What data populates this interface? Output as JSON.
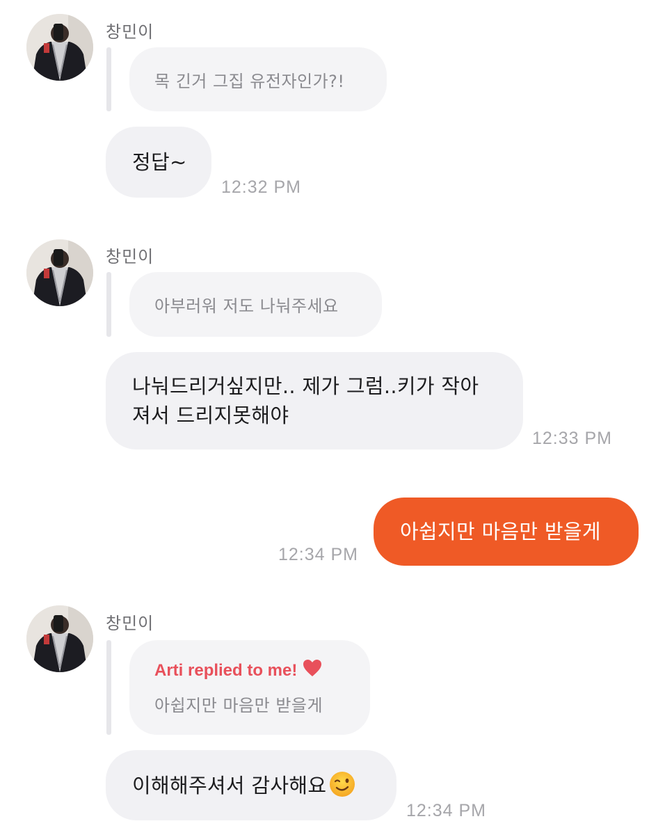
{
  "messages": [
    {
      "sender": "창민이",
      "quote": "목 긴거 그집 유전자인가?!",
      "text": "정답~",
      "time": "12:32 PM"
    },
    {
      "sender": "창민이",
      "quote": "아부러워 저도 나눠주세요",
      "text_line1": "나눠드리거싶지만.. 제가 그럼..키가 작아",
      "text_line2": "져서 드리지못해야",
      "time": "12:33 PM"
    },
    {
      "mine_text": "아쉽지만 마음만 받을게",
      "time": "12:34 PM"
    },
    {
      "sender": "창민이",
      "reply_label": "Arti replied to me!",
      "quote": "아쉽지만 마음만 받을게",
      "text": "이해해주셔서 감사해요",
      "time": "12:34 PM"
    }
  ],
  "icons": {
    "reply_heart": "heart-icon",
    "emoji": "winking-face-icon",
    "avatar": "profile-avatar"
  },
  "colors": {
    "my_bubble": "#ef5a26",
    "their_bubble": "#f1f1f4",
    "reply_label": "#e8505b",
    "timestamp": "#a6a6aa"
  }
}
